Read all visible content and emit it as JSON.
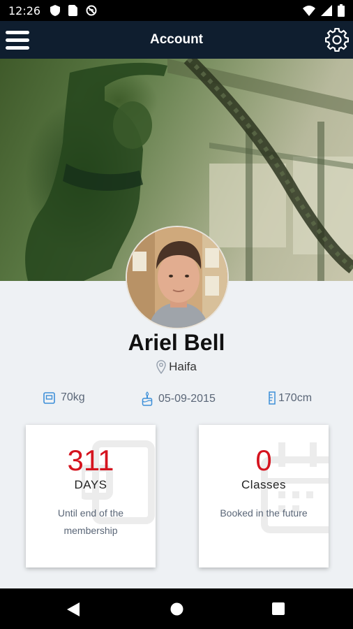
{
  "status_bar": {
    "time": "12:26",
    "left_icons": [
      "shield-icon",
      "sim-card-icon",
      "no-disturb-icon"
    ],
    "right_icons": [
      "wifi-icon",
      "signal-icon",
      "battery-icon"
    ]
  },
  "app_bar": {
    "title": "Account",
    "menu_icon": "hamburger-menu-icon",
    "settings_icon": "gear-icon"
  },
  "profile": {
    "name": "Ariel Bell",
    "location": "Haifa",
    "weight": "70kg",
    "birthdate": "05-09-2015",
    "height": "170cm"
  },
  "cards": [
    {
      "number": "311",
      "label": "DAYS",
      "sub": "Until end of the membership"
    },
    {
      "number": "0",
      "label": "Classes",
      "sub": "Booked in the future"
    }
  ],
  "nav_bar": {
    "icons": [
      "back-icon",
      "home-icon",
      "recents-icon"
    ]
  },
  "colors": {
    "app_bar": "#0f1e2f",
    "accent_red": "#d5141f",
    "icon_blue": "#3d8fd8"
  }
}
